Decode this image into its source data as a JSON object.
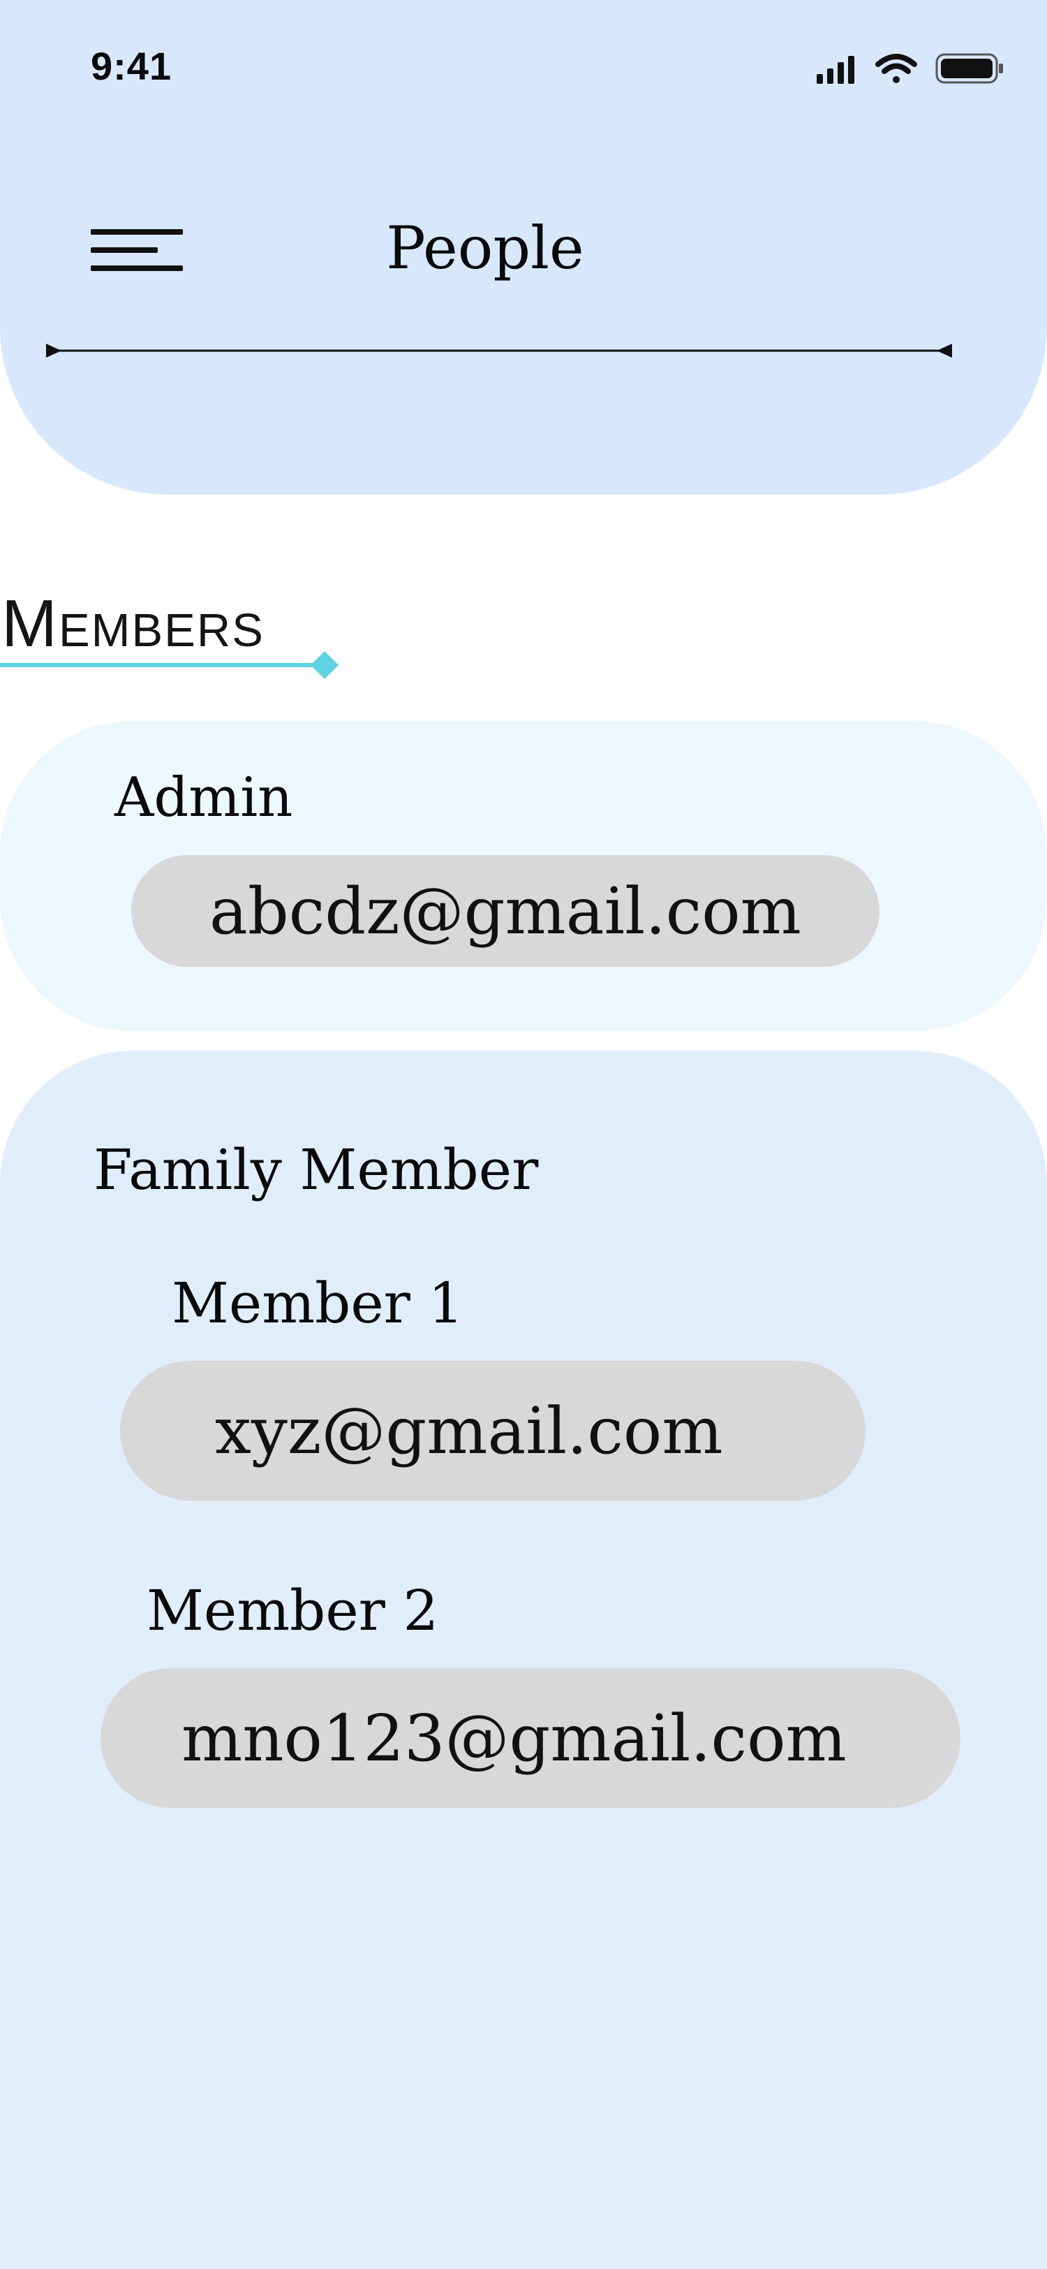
{
  "status_bar": {
    "time": "9:41"
  },
  "header": {
    "title": "People"
  },
  "section": {
    "heading": "Members"
  },
  "admin": {
    "label": "Admin",
    "email": "abcdz@gmail.com"
  },
  "family": {
    "title": "Family Member",
    "members": [
      {
        "label": "Member 1",
        "email": "xyz@gmail.com"
      },
      {
        "label": "Member 2",
        "email": "mno123@gmail.com"
      }
    ]
  },
  "colors": {
    "header_bg": "#d8e8fc",
    "admin_card_bg": "#edf8fe",
    "family_card_bg": "#e0eefc",
    "pill_bg": "#d8d8d8",
    "accent": "#5fd3e2"
  }
}
